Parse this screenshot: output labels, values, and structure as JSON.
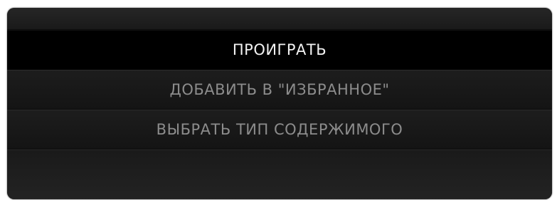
{
  "menu": {
    "items": [
      {
        "label": "ПРОИГРАТЬ",
        "selected": true
      },
      {
        "label": "ДОБАВИТЬ В \"ИЗБРАННОЕ\"",
        "selected": false
      },
      {
        "label": "ВЫБРАТЬ ТИП СОДЕРЖИМОГО",
        "selected": false
      }
    ]
  },
  "colors": {
    "background": "#151515",
    "selected_background": "#000000",
    "selected_text": "#f2f2f2",
    "text": "#8c8c8c"
  }
}
